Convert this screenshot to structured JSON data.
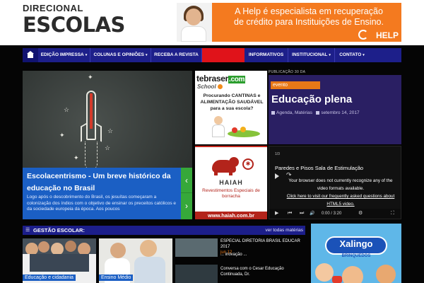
{
  "logo": {
    "top": "DIRECIONAL",
    "bottom": "ESCOLAS"
  },
  "banner": {
    "line1": "A Help é especialista em recuperação",
    "line2": "de crédito para Instituições de Ensino.",
    "brand": "HELP"
  },
  "nav": {
    "items": [
      {
        "label": "EDIÇÃO IMPRESSA",
        "has_dropdown": true
      },
      {
        "label": "COLUNAS E OPINIÕES",
        "has_dropdown": true
      },
      {
        "label": "RECEBA A REVISTA",
        "has_dropdown": false
      },
      {
        "label": "INFORMATIVOS",
        "has_dropdown": false
      },
      {
        "label": "INSTITUCIONAL",
        "has_dropdown": true
      },
      {
        "label": "CONTATO",
        "has_dropdown": true
      }
    ],
    "home_icon": "home-icon",
    "dropdown_arrow": "▾"
  },
  "slider": {
    "title": "Escolacentrismo - Um breve histórico da educação no Brasil",
    "description": "Logo após o descobrimento do Brasil, os jesuítas começaram a colonização dos índios com o objetivo de ensinar os preceitos católicos e da sociedade europeia da época. Aos poucos",
    "prev": "‹",
    "next": "›"
  },
  "ad_tebraser": {
    "brand_main": "tebraser",
    "brand_dot": ".com",
    "school": "School",
    "text": "Procurando CANTINAS e ALIMENTAÇÃO SAUDÁVEL para a sua escola?"
  },
  "ad_haiah": {
    "badge": "✱",
    "name": "HAIAH",
    "desc": "Revestimentos Especiais de borracha",
    "url": "www.haiah.com.br"
  },
  "event": {
    "pub_label": "PUBLICAÇÃO 30 DA",
    "badge": "evento",
    "title": "Educação plena",
    "categories": "Agenda, Matérias",
    "date": "setembro 14, 2017"
  },
  "video": {
    "counter": "1/3",
    "title": "Paredes e Pisos Sala de Estimulação",
    "msg_line1": "Your browser does not currently recognize any of the",
    "msg_line2": "video formats available.",
    "msg_link": "Click here to visit our frequently asked questions about",
    "msg_link2": "HTML5 video.",
    "time": "0:00 / 3:20",
    "play": "▶",
    "skip_back": "⏮",
    "skip_fwd": "⏭",
    "volume": "🔊",
    "settings": "⚙",
    "fullscreen": "⛶",
    "share": "↷"
  },
  "gestao": {
    "title": "GESTÃO ESCOLAR:",
    "view_all": "ver todas matérias",
    "thumbs": [
      {
        "category": "Educação e cidadania"
      },
      {
        "category": "Ensino Médio"
      }
    ],
    "side_items": [
      {
        "text": "ESPECIAL DIRETORIA BRASIL EDUCAR 2017",
        "date": "jun 12"
      },
      {
        "text": "... inovação ...",
        "date": ""
      },
      {
        "text": "Conversa com o Cesar Educação Continuada, Dr.",
        "date": ""
      }
    ]
  },
  "ad_xalingo": {
    "brand": "Xalingo",
    "sub": "BRINQUEDOS"
  },
  "colors": {
    "nav_blue": "#1d1f8a",
    "accent_blue": "#1b5fc4",
    "accent_orange": "#e87817",
    "event_purple": "#2a1f63",
    "slider_green": "#36a83a",
    "nav_red": "#e0131a"
  }
}
